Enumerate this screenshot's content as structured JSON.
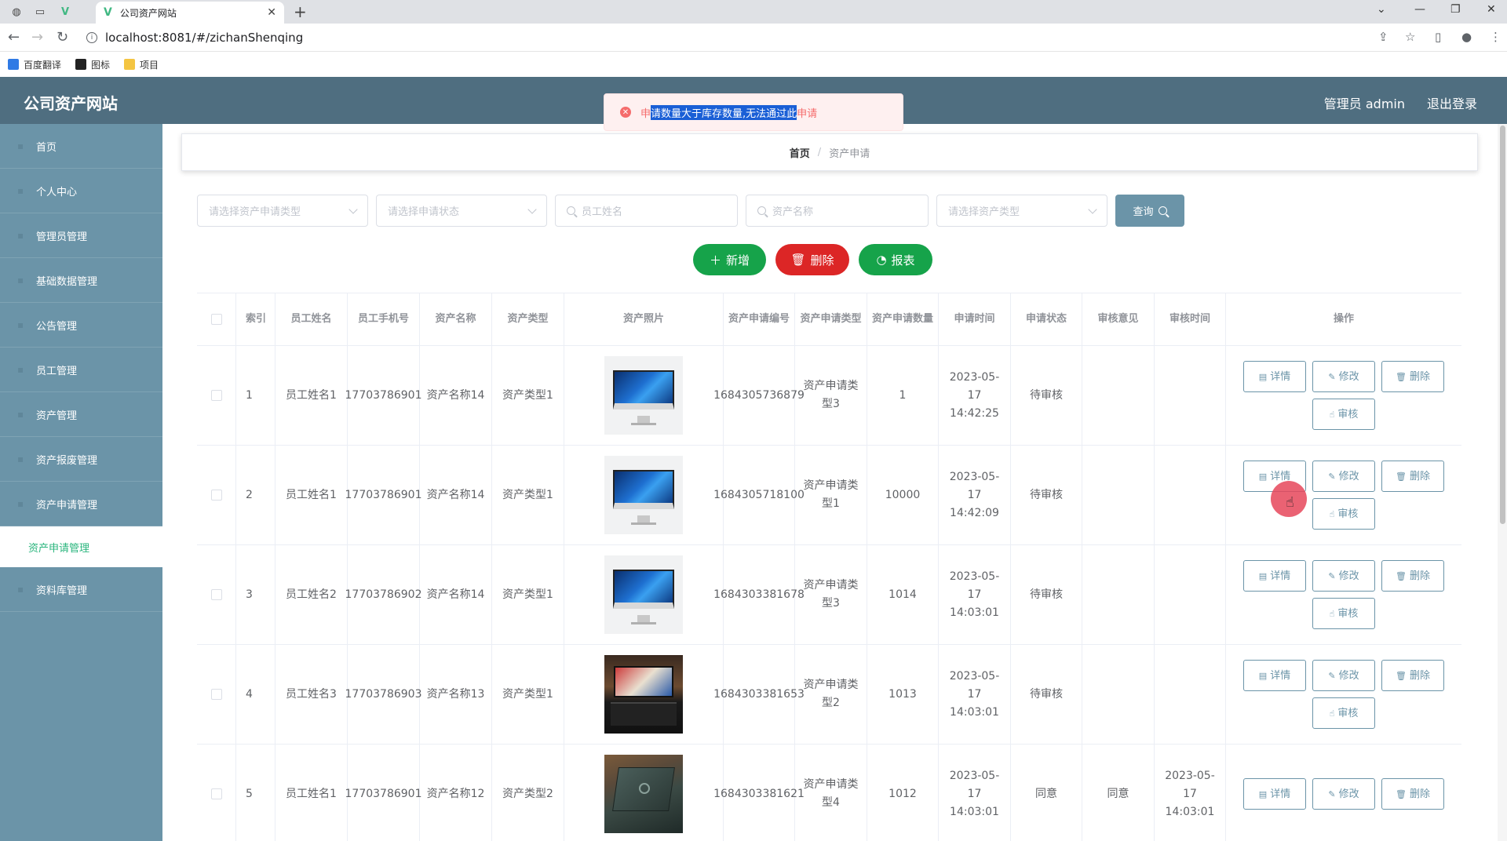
{
  "browser": {
    "tab_title": "公司资产网站",
    "url": "localhost:8081/#/zichanShenqing",
    "bookmarks": [
      "百度翻译",
      "图标",
      "项目"
    ]
  },
  "header": {
    "title": "公司资产网站",
    "user": "管理员 admin",
    "logout": "退出登录"
  },
  "toast": {
    "prefix": "申",
    "selected": "请数量大于库存数量,无法通过此",
    "suffix": "申请"
  },
  "sidebar": {
    "items": [
      "首页",
      "个人中心",
      "管理员管理",
      "基础数据管理",
      "公告管理",
      "员工管理",
      "资产管理",
      "资产报废管理",
      "资产申请管理"
    ],
    "sub_item": "资产申请管理",
    "last_item": "资料库管理"
  },
  "breadcrumb": {
    "home": "首页",
    "current": "资产申请"
  },
  "filters": {
    "apply_type": "请选择资产申请类型",
    "apply_status": "请选择申请状态",
    "staff_name": "员工姓名",
    "asset_name": "资产名称",
    "asset_type": "请选择资产类型",
    "query": "查询"
  },
  "actions": {
    "add": "新增",
    "delete": "删除",
    "report": "报表"
  },
  "table": {
    "headers": [
      "索引",
      "员工姓名",
      "员工手机号",
      "资产名称",
      "资产类型",
      "资产照片",
      "资产申请编号",
      "资产申请类型",
      "资产申请数量",
      "申请时间",
      "申请状态",
      "审核意见",
      "审核时间",
      "操作"
    ],
    "ops": {
      "detail": "详情",
      "edit": "修改",
      "delete": "删除",
      "audit": "审核"
    },
    "rows": [
      {
        "idx": "1",
        "name": "员工姓名1",
        "phone": "17703786901",
        "asset": "资产名称14",
        "atype": "资产类型1",
        "img": "imac",
        "no": "1684305736879",
        "apply_type": "资产申请类型3",
        "qty": "1",
        "time": "2023-05-17 14:42:25",
        "status": "待审核",
        "opinion": "",
        "audit_time": ""
      },
      {
        "idx": "2",
        "name": "员工姓名1",
        "phone": "17703786901",
        "asset": "资产名称14",
        "atype": "资产类型1",
        "img": "imac",
        "no": "1684305718100",
        "apply_type": "资产申请类型1",
        "qty": "10000",
        "time": "2023-05-17 14:42:09",
        "status": "待审核",
        "opinion": "",
        "audit_time": ""
      },
      {
        "idx": "3",
        "name": "员工姓名2",
        "phone": "17703786902",
        "asset": "资产名称14",
        "atype": "资产类型1",
        "img": "imac",
        "no": "1684303381678",
        "apply_type": "资产申请类型3",
        "qty": "1014",
        "time": "2023-05-17 14:03:01",
        "status": "待审核",
        "opinion": "",
        "audit_time": ""
      },
      {
        "idx": "4",
        "name": "员工姓名3",
        "phone": "17703786903",
        "asset": "资产名称13",
        "atype": "资产类型1",
        "img": "laptop1",
        "no": "1684303381653",
        "apply_type": "资产申请类型2",
        "qty": "1013",
        "time": "2023-05-17 14:03:01",
        "status": "待审核",
        "opinion": "",
        "audit_time": ""
      },
      {
        "idx": "5",
        "name": "员工姓名1",
        "phone": "17703786901",
        "asset": "资产名称12",
        "atype": "资产类型2",
        "img": "laptop2",
        "no": "1684303381621",
        "apply_type": "资产申请类型4",
        "qty": "1012",
        "time": "2023-05-17 14:03:01",
        "status": "同意",
        "opinion": "同意",
        "audit_time": "2023-05-17 14:03:01"
      }
    ]
  },
  "colors": {
    "header": "#4f6e80",
    "sidebar": "#6b94a8",
    "green": "#16a34a",
    "red": "#dc2626",
    "toast_error": "#f56c6c"
  }
}
